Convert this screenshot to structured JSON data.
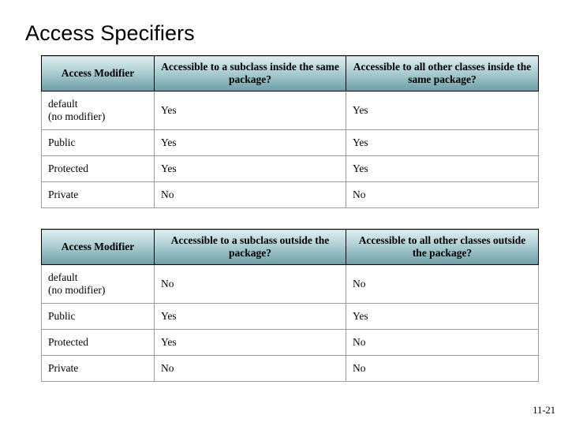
{
  "slide": {
    "title": "Access Specifiers",
    "footer": "11-21"
  },
  "tables": [
    {
      "id": "table1",
      "headers": [
        "Access Modifier",
        "Accessible to a subclass inside the same package?",
        "Accessible to all other classes inside the same package?"
      ],
      "rows": [
        {
          "modifier_line1": "default",
          "modifier_line2": "(no modifier)",
          "c1": "Yes",
          "c2": "Yes"
        },
        {
          "modifier_line1": "Public",
          "modifier_line2": "",
          "c1": "Yes",
          "c2": "Yes"
        },
        {
          "modifier_line1": "Protected",
          "modifier_line2": "",
          "c1": "Yes",
          "c2": "Yes"
        },
        {
          "modifier_line1": "Private",
          "modifier_line2": "",
          "c1": "No",
          "c2": "No"
        }
      ]
    },
    {
      "id": "table2",
      "headers": [
        "Access Modifier",
        "Accessible to a subclass outside the package?",
        "Accessible to all other classes outside the package?"
      ],
      "rows": [
        {
          "modifier_line1": "default",
          "modifier_line2": "(no modifier)",
          "c1": "No",
          "c2": "No"
        },
        {
          "modifier_line1": "Public",
          "modifier_line2": "",
          "c1": "Yes",
          "c2": "Yes"
        },
        {
          "modifier_line1": "Protected",
          "modifier_line2": "",
          "c1": "Yes",
          "c2": "No"
        },
        {
          "modifier_line1": "Private",
          "modifier_line2": "",
          "c1": "No",
          "c2": "No"
        }
      ]
    }
  ]
}
